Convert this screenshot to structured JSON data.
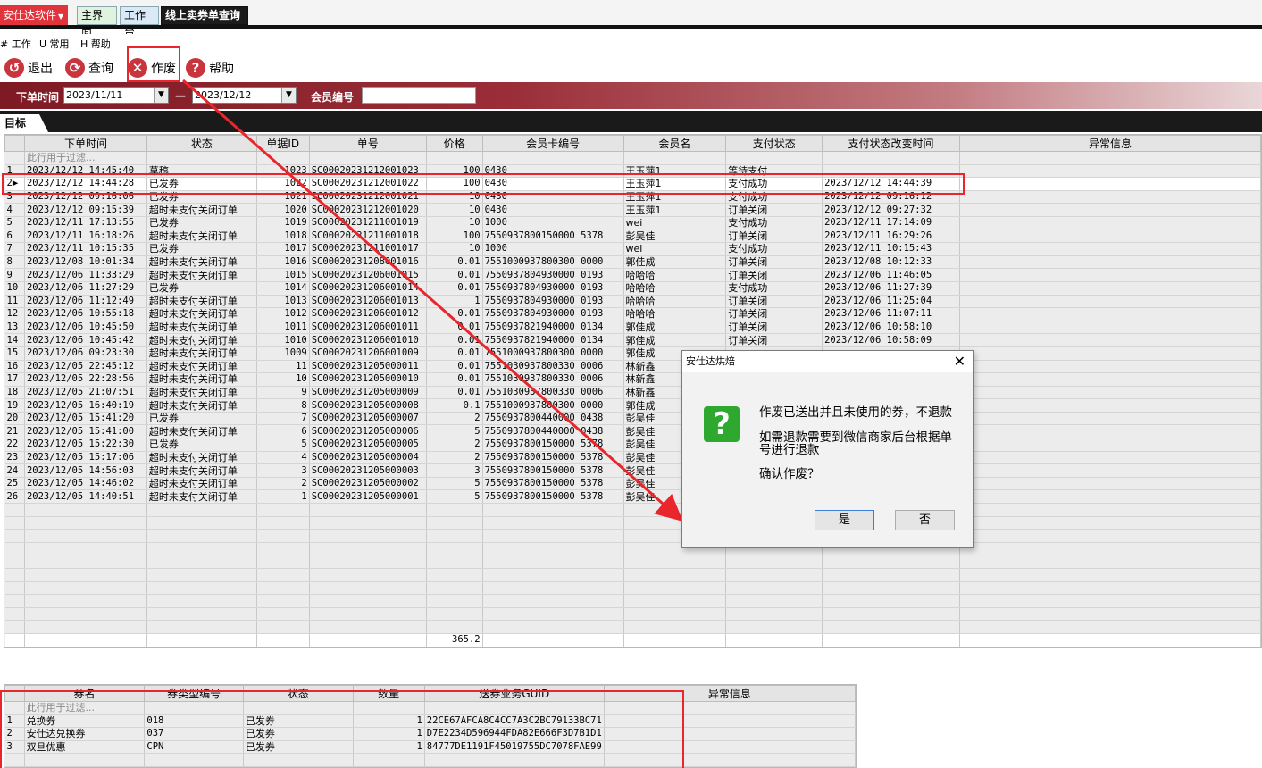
{
  "app": {
    "menu_label": "安仕达软件",
    "tabs": [
      "主界面",
      "工作台",
      "线上卖券单查询"
    ]
  },
  "menubar": [
    "# 工作",
    "U 常用",
    "H 帮助"
  ],
  "toolbar": {
    "exit": "退出",
    "query": "查询",
    "void": "作废",
    "help": "帮助"
  },
  "filter": {
    "order_time_label": "下单时间",
    "start_date": "2023/11/11",
    "dash": "—",
    "end_date": "2023/12/12",
    "member_label": "会员编号",
    "member_value": ""
  },
  "target_tab": "目标",
  "grid": {
    "columns": [
      "下单时间",
      "状态",
      "单据ID",
      "单号",
      "价格",
      "会员卡编号",
      "会员名",
      "支付状态",
      "支付状态改变时间",
      "异常信息"
    ],
    "filter_hint": "此行用于过滤...",
    "rows": [
      [
        "1",
        "2023/12/12 14:45:40",
        "草稿",
        "1023",
        "SC00020231212001023",
        "100",
        "0430",
        "王玉萍1",
        "等待支付",
        "",
        ""
      ],
      [
        "2",
        "2023/12/12 14:44:28",
        "已发券",
        "1022",
        "SC00020231212001022",
        "100",
        "0430",
        "王玉萍1",
        "支付成功",
        "2023/12/12 14:44:39",
        ""
      ],
      [
        "3",
        "2023/12/12 09:16:06",
        "已发券",
        "1021",
        "SC00020231212001021",
        "10",
        "0430",
        "王玉萍1",
        "支付成功",
        "2023/12/12 09:16:12",
        ""
      ],
      [
        "4",
        "2023/12/12 09:15:39",
        "超时未支付关闭订单",
        "1020",
        "SC00020231212001020",
        "10",
        "0430",
        "王玉萍1",
        "订单关闭",
        "2023/12/12 09:27:32",
        ""
      ],
      [
        "5",
        "2023/12/11 17:13:55",
        "已发券",
        "1019",
        "SC00020231211001019",
        "10",
        "1000",
        "wei",
        "支付成功",
        "2023/12/11 17:14:09",
        ""
      ],
      [
        "6",
        "2023/12/11 16:18:26",
        "超时未支付关闭订单",
        "1018",
        "SC00020231211001018",
        "100",
        "7550937800150000 5378",
        "彭吴佳",
        "订单关闭",
        "2023/12/11 16:29:26",
        ""
      ],
      [
        "7",
        "2023/12/11 10:15:35",
        "已发券",
        "1017",
        "SC00020231211001017",
        "10",
        "1000",
        "wei",
        "支付成功",
        "2023/12/11 10:15:43",
        ""
      ],
      [
        "8",
        "2023/12/08 10:01:34",
        "超时未支付关闭订单",
        "1016",
        "SC00020231208001016",
        "0.01",
        "7551000937800300 0000",
        "郭佳成",
        "订单关闭",
        "2023/12/08 10:12:33",
        ""
      ],
      [
        "9",
        "2023/12/06 11:33:29",
        "超时未支付关闭订单",
        "1015",
        "SC00020231206001015",
        "0.01",
        "7550937804930000 0193",
        "哈哈哈",
        "订单关闭",
        "2023/12/06 11:46:05",
        ""
      ],
      [
        "10",
        "2023/12/06 11:27:29",
        "已发券",
        "1014",
        "SC00020231206001014",
        "0.01",
        "7550937804930000 0193",
        "哈哈哈",
        "支付成功",
        "2023/12/06 11:27:39",
        ""
      ],
      [
        "11",
        "2023/12/06 11:12:49",
        "超时未支付关闭订单",
        "1013",
        "SC00020231206001013",
        "1",
        "7550937804930000 0193",
        "哈哈哈",
        "订单关闭",
        "2023/12/06 11:25:04",
        ""
      ],
      [
        "12",
        "2023/12/06 10:55:18",
        "超时未支付关闭订单",
        "1012",
        "SC00020231206001012",
        "0.01",
        "7550937804930000 0193",
        "哈哈哈",
        "订单关闭",
        "2023/12/06 11:07:11",
        ""
      ],
      [
        "13",
        "2023/12/06 10:45:50",
        "超时未支付关闭订单",
        "1011",
        "SC00020231206001011",
        "0.01",
        "7550937821940000 0134",
        "郭佳成",
        "订单关闭",
        "2023/12/06 10:58:10",
        ""
      ],
      [
        "14",
        "2023/12/06 10:45:42",
        "超时未支付关闭订单",
        "1010",
        "SC00020231206001010",
        "0.01",
        "7550937821940000 0134",
        "郭佳成",
        "订单关闭",
        "2023/12/06 10:58:09",
        ""
      ],
      [
        "15",
        "2023/12/06 09:23:30",
        "超时未支付关闭订单",
        "1009",
        "SC00020231206001009",
        "0.01",
        "7551000937800300 0000",
        "郭佳成",
        "",
        "",
        ""
      ],
      [
        "16",
        "2023/12/05 22:45:12",
        "超时未支付关闭订单",
        "11",
        "SC00020231205000011",
        "0.01",
        "7551030937800330 0006",
        "林新鑫",
        "",
        "",
        ""
      ],
      [
        "17",
        "2023/12/05 22:28:56",
        "超时未支付关闭订单",
        "10",
        "SC00020231205000010",
        "0.01",
        "7551030937800330 0006",
        "林新鑫",
        "",
        "",
        ""
      ],
      [
        "18",
        "2023/12/05 21:07:51",
        "超时未支付关闭订单",
        "9",
        "SC00020231205000009",
        "0.01",
        "7551030937800330 0006",
        "林新鑫",
        "",
        "",
        ""
      ],
      [
        "19",
        "2023/12/05 16:40:19",
        "超时未支付关闭订单",
        "8",
        "SC00020231205000008",
        "0.1",
        "7551000937800300 0000",
        "郭佳成",
        "",
        "",
        ""
      ],
      [
        "20",
        "2023/12/05 15:41:20",
        "已发券",
        "7",
        "SC00020231205000007",
        "2",
        "7550937800440000 0438",
        "彭吴佳",
        "",
        "",
        ""
      ],
      [
        "21",
        "2023/12/05 15:41:00",
        "超时未支付关闭订单",
        "6",
        "SC00020231205000006",
        "5",
        "7550937800440000 0438",
        "彭吴佳",
        "",
        "",
        ""
      ],
      [
        "22",
        "2023/12/05 15:22:30",
        "已发券",
        "5",
        "SC00020231205000005",
        "2",
        "7550937800150000 5378",
        "彭吴佳",
        "",
        "",
        ""
      ],
      [
        "23",
        "2023/12/05 15:17:06",
        "超时未支付关闭订单",
        "4",
        "SC00020231205000004",
        "2",
        "7550937800150000 5378",
        "彭吴佳",
        "",
        "",
        ""
      ],
      [
        "24",
        "2023/12/05 14:56:03",
        "超时未支付关闭订单",
        "3",
        "SC00020231205000003",
        "3",
        "7550937800150000 5378",
        "彭吴佳",
        "",
        "",
        ""
      ],
      [
        "25",
        "2023/12/05 14:46:02",
        "超时未支付关闭订单",
        "2",
        "SC00020231205000002",
        "5",
        "7550937800150000 5378",
        "彭吴佳",
        "",
        "",
        ""
      ],
      [
        "26",
        "2023/12/05 14:40:51",
        "超时未支付关闭订单",
        "1",
        "SC00020231205000001",
        "5",
        "7550937800150000 5378",
        "彭吴佳",
        "",
        "",
        ""
      ]
    ],
    "selected_row": 2,
    "price_total": "365.2"
  },
  "grid2": {
    "columns": [
      "券名",
      "券类型编号",
      "状态",
      "数量",
      "送券业务GUID",
      "异常信息"
    ],
    "filter_hint": "此行用于过滤...",
    "rows": [
      [
        "1",
        "兑换券",
        "018",
        "已发券",
        "1",
        "22CE67AFCA8C4CC7A3C2BC79133BC71",
        ""
      ],
      [
        "2",
        "安仕达兑换券",
        "037",
        "已发券",
        "1",
        "D7E2234D596944FDA82E666F3D7B1D1",
        ""
      ],
      [
        "3",
        "双旦优惠",
        "CPN",
        "已发券",
        "1",
        "84777DE1191F45019755DC7078FAE99",
        ""
      ]
    ]
  },
  "dialog": {
    "title": "安仕达烘焙",
    "close": "✕",
    "icon": "?",
    "line1": "作废已送出并且未使用的券，不退款",
    "line2": "如需退款需要到微信商家后台根据单号进行退款",
    "line3": "确认作废？",
    "yes": "是",
    "no": "否"
  },
  "colors": {
    "accent_red": "#e8262c",
    "dialog_icon_green": "#2ea82e"
  }
}
